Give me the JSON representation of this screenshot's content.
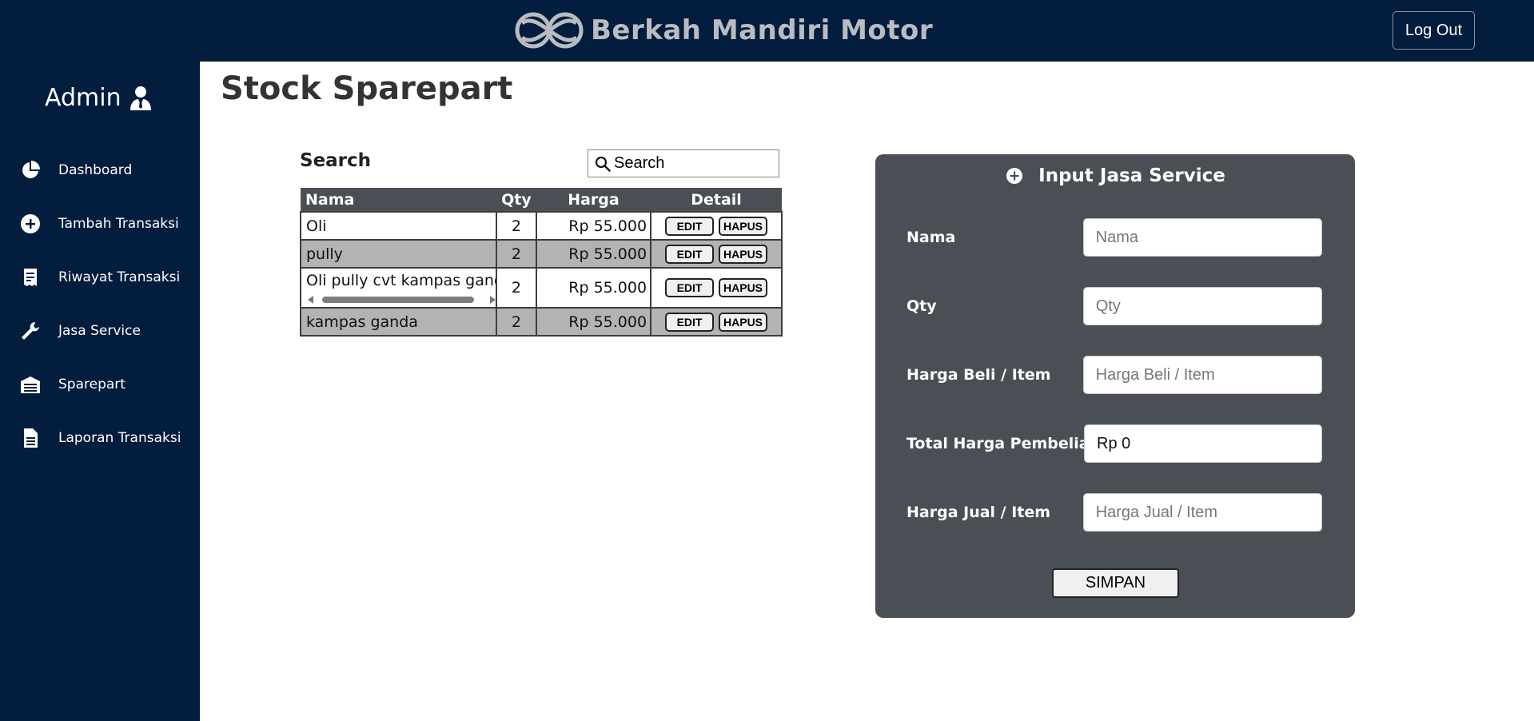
{
  "header": {
    "brand": "Berkah Mandiri Motor",
    "logout_label": "Log Out"
  },
  "sidebar": {
    "user": "Admin",
    "items": [
      {
        "label": "Dashboard",
        "icon": "pie-chart-icon"
      },
      {
        "label": "Tambah Transaksi",
        "icon": "plus-circle-icon"
      },
      {
        "label": "Riwayat Transaksi",
        "icon": "receipt-icon"
      },
      {
        "label": "Jasa Service",
        "icon": "wrench-icon"
      },
      {
        "label": "Sparepart",
        "icon": "warehouse-icon"
      },
      {
        "label": "Laporan Transaksi",
        "icon": "document-icon"
      }
    ]
  },
  "main": {
    "title": "Stock Sparepart",
    "search_label": "Search",
    "search_placeholder": "Search",
    "table": {
      "headers": [
        "Nama",
        "Qty",
        "Harga",
        "Detail"
      ],
      "edit_label": "EDIT",
      "hapus_label": "HAPUS",
      "rows": [
        {
          "nama": "Oli",
          "qty": "2",
          "harga": "Rp 55.000"
        },
        {
          "nama": "pully",
          "qty": "2",
          "harga": "Rp 55.000"
        },
        {
          "nama": "Oli pully cvt kampas ganda",
          "qty": "2",
          "harga": "Rp 55.000"
        },
        {
          "nama": "kampas ganda",
          "qty": "2",
          "harga": "Rp 55.000"
        }
      ]
    }
  },
  "form": {
    "title": "Input Jasa Service",
    "fields": [
      {
        "label": "Nama",
        "placeholder": "Nama",
        "value": ""
      },
      {
        "label": "Qty",
        "placeholder": "Qty",
        "value": ""
      },
      {
        "label": "Harga Beli / Item",
        "placeholder": "Harga Beli / Item",
        "value": ""
      },
      {
        "label": "Total Harga Pembelian",
        "placeholder": "",
        "value": "Rp 0"
      },
      {
        "label": "Harga Jual / Item",
        "placeholder": "Harga Jual / Item",
        "value": ""
      }
    ],
    "submit_label": "SIMPAN"
  },
  "colors": {
    "navy": "#021d3d",
    "panel": "#4a4f56",
    "row_alt": "#b3b3b3"
  }
}
